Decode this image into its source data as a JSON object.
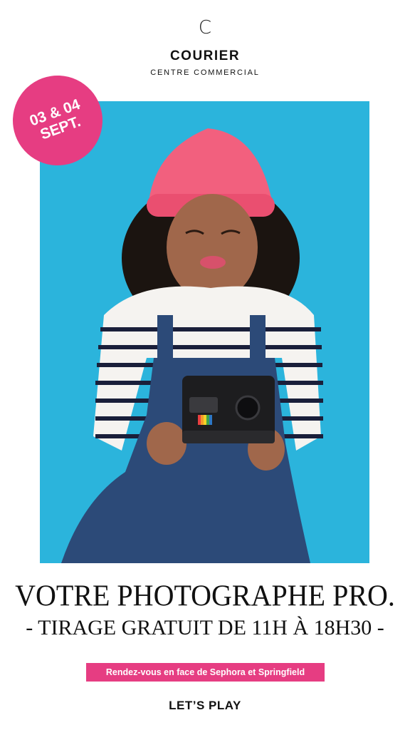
{
  "header": {
    "logo_mark": "C",
    "brand": "COURIER",
    "brand_sub": "CENTRE COMMERCIAL"
  },
  "badge": {
    "line1": "03 & 04",
    "line2": "SEPT.",
    "color": "#e63d82"
  },
  "photo": {
    "background": "#2bb4dc",
    "subject": "child with pink beanie holding an instant camera"
  },
  "headline": "VOTRE PHOTOGRAPHE PRO.",
  "subline": "- TIRAGE GRATUIT DE 11H À 18H30 -",
  "info_pill": "Rendez-vous en face de Sephora et Springfield",
  "cta": "LET’S PLAY"
}
